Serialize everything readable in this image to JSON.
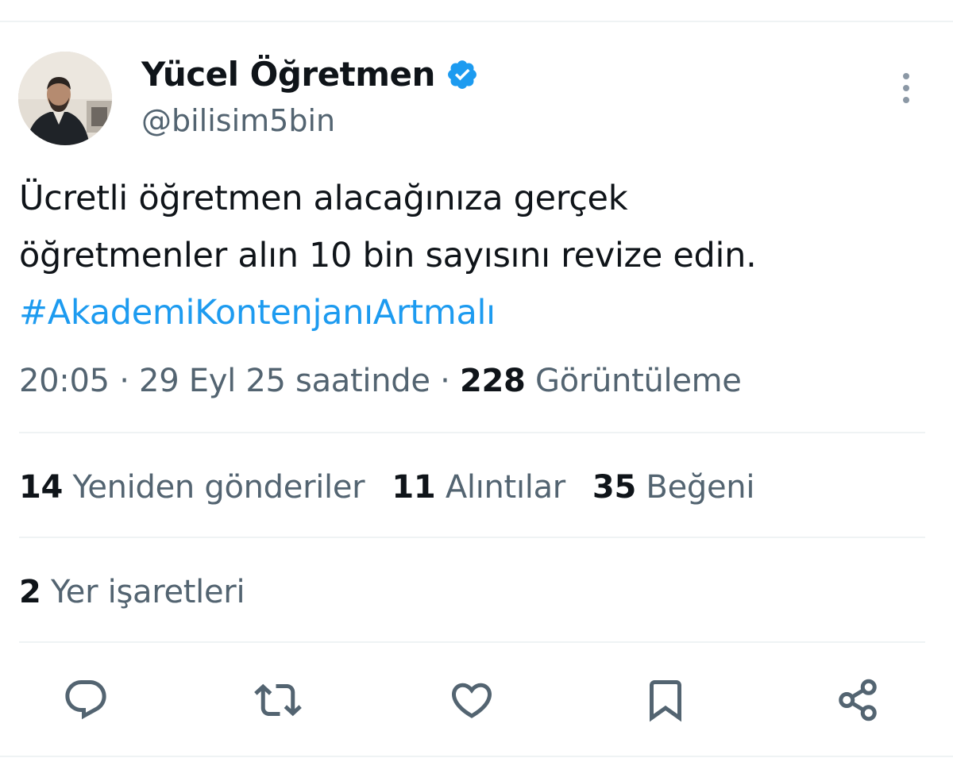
{
  "author": {
    "display_name": "Yücel Öğretmen",
    "handle": "@bilisim5bin",
    "verified": true
  },
  "tweet": {
    "text_line1": "Ücretli öğretmen alacağınıza gerçek",
    "text_line2": "öğretmenler alın 10 bin sayısını revize edin.",
    "hashtag": "#AkademiKontenjanıArtmalı"
  },
  "meta": {
    "time": "20:05",
    "separator": "·",
    "date": "29 Eyl 25 saatinde",
    "views_count": "228",
    "views_label": "Görüntüleme"
  },
  "stats": {
    "reposts_count": "14",
    "reposts_label": "Yeniden gönderiler",
    "quotes_count": "11",
    "quotes_label": "Alıntılar",
    "likes_count": "35",
    "likes_label": "Beğeni"
  },
  "bookmarks": {
    "count": "2",
    "label": "Yer işaretleri"
  },
  "actions": [
    "reply-icon",
    "repost-icon",
    "like-icon",
    "bookmark-icon",
    "share-icon"
  ],
  "colors": {
    "accent": "#1d9bf0",
    "text_primary": "#0f1419",
    "text_secondary": "#536471",
    "divider": "#eff3f4"
  }
}
